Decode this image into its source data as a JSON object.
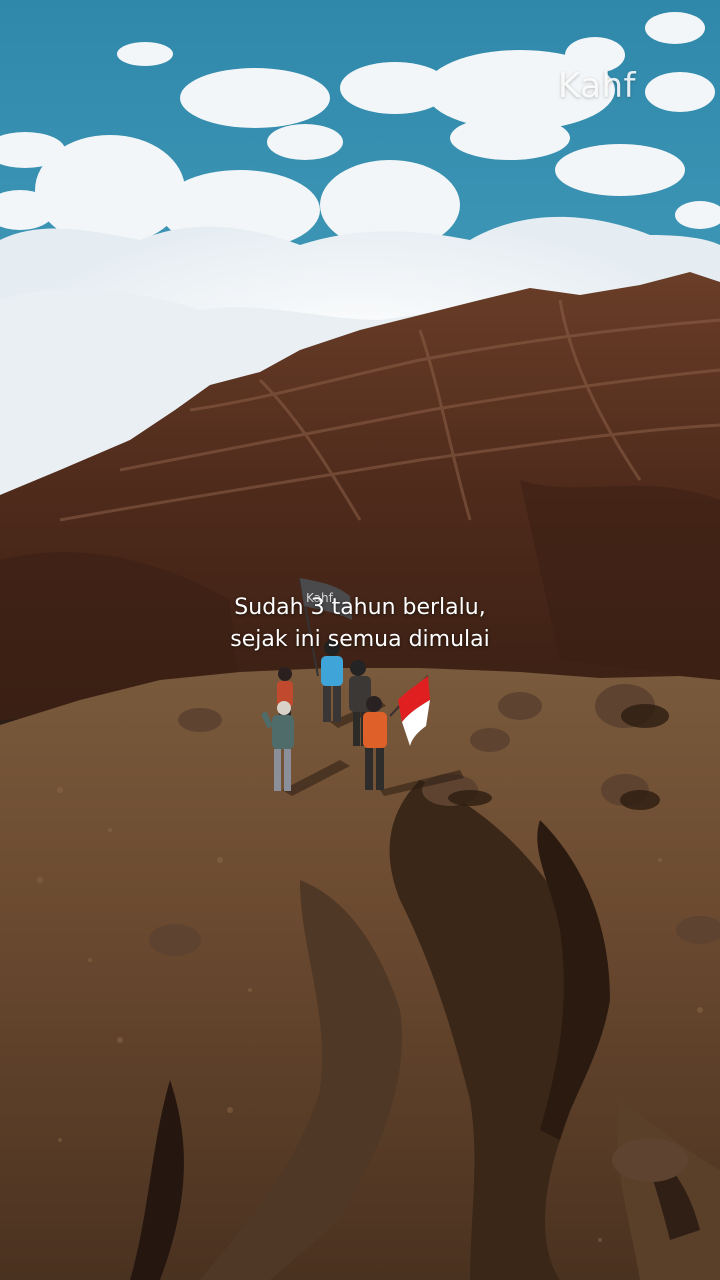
{
  "watermark": {
    "text": "Kahf"
  },
  "caption": {
    "line1": "Sudah 3 tahun berlalu,",
    "line2": "sejak ini semua dimulai"
  },
  "colors": {
    "sky": "#3a8fae",
    "cloud": "#f4f6f8",
    "cliff": "#5a3322",
    "ground": "#6b4a30",
    "flag_red": "#e02020",
    "flag_white": "#ffffff"
  }
}
